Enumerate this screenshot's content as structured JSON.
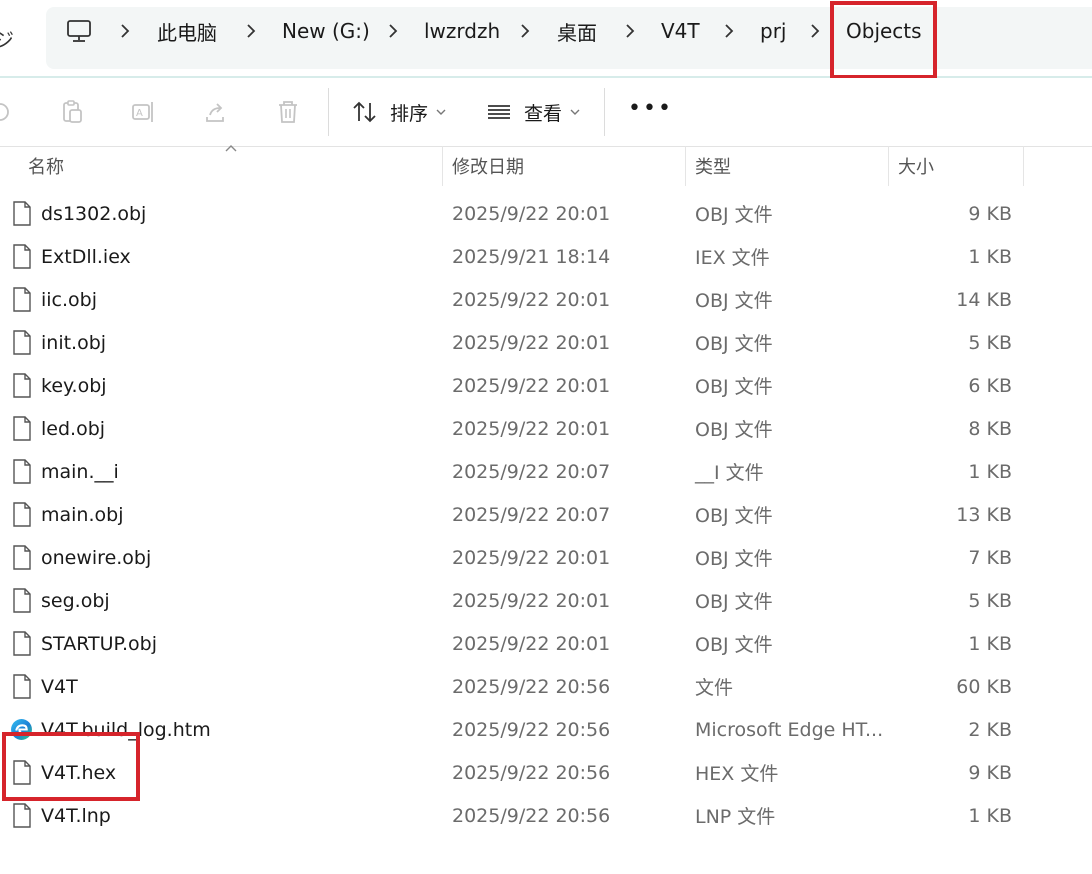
{
  "breadcrumb": {
    "nav_partial": "ジ",
    "items": [
      "此电脑",
      "New (G:)",
      "lwzrdzh",
      "桌面",
      "V4T",
      "prj",
      "Objects"
    ]
  },
  "toolbar": {
    "sort_label": "排序",
    "view_label": "查看",
    "more_label": "•••"
  },
  "columns": {
    "name": "名称",
    "date": "修改日期",
    "type": "类型",
    "size": "大小"
  },
  "files": [
    {
      "name": "ds1302.obj",
      "date": "2025/9/22 20:01",
      "type": "OBJ 文件",
      "size": "9 KB",
      "icon": "file-icon"
    },
    {
      "name": "ExtDll.iex",
      "date": "2025/9/21 18:14",
      "type": "IEX 文件",
      "size": "1 KB",
      "icon": "file-icon"
    },
    {
      "name": "iic.obj",
      "date": "2025/9/22 20:01",
      "type": "OBJ 文件",
      "size": "14 KB",
      "icon": "file-icon"
    },
    {
      "name": "init.obj",
      "date": "2025/9/22 20:01",
      "type": "OBJ 文件",
      "size": "5 KB",
      "icon": "file-icon"
    },
    {
      "name": "key.obj",
      "date": "2025/9/22 20:01",
      "type": "OBJ 文件",
      "size": "6 KB",
      "icon": "file-icon"
    },
    {
      "name": "led.obj",
      "date": "2025/9/22 20:01",
      "type": "OBJ 文件",
      "size": "8 KB",
      "icon": "file-icon"
    },
    {
      "name": "main.__i",
      "date": "2025/9/22 20:07",
      "type": "__I 文件",
      "size": "1 KB",
      "icon": "file-icon"
    },
    {
      "name": "main.obj",
      "date": "2025/9/22 20:07",
      "type": "OBJ 文件",
      "size": "13 KB",
      "icon": "file-icon"
    },
    {
      "name": "onewire.obj",
      "date": "2025/9/22 20:01",
      "type": "OBJ 文件",
      "size": "7 KB",
      "icon": "file-icon"
    },
    {
      "name": "seg.obj",
      "date": "2025/9/22 20:01",
      "type": "OBJ 文件",
      "size": "5 KB",
      "icon": "file-icon"
    },
    {
      "name": "STARTUP.obj",
      "date": "2025/9/22 20:01",
      "type": "OBJ 文件",
      "size": "1 KB",
      "icon": "file-icon"
    },
    {
      "name": "V4T",
      "date": "2025/9/22 20:56",
      "type": "文件",
      "size": "60 KB",
      "icon": "file-icon"
    },
    {
      "name": "V4T.build_log.htm",
      "date": "2025/9/22 20:56",
      "type": "Microsoft Edge HT...",
      "size": "2 KB",
      "icon": "edge-icon"
    },
    {
      "name": "V4T.hex",
      "date": "2025/9/22 20:56",
      "type": "HEX 文件",
      "size": "9 KB",
      "icon": "file-icon"
    },
    {
      "name": "V4T.lnp",
      "date": "2025/9/22 20:56",
      "type": "LNP 文件",
      "size": "1 KB",
      "icon": "file-icon"
    }
  ],
  "colors": {
    "highlight": "#d6242b",
    "address_bg": "#f3f6f6"
  }
}
